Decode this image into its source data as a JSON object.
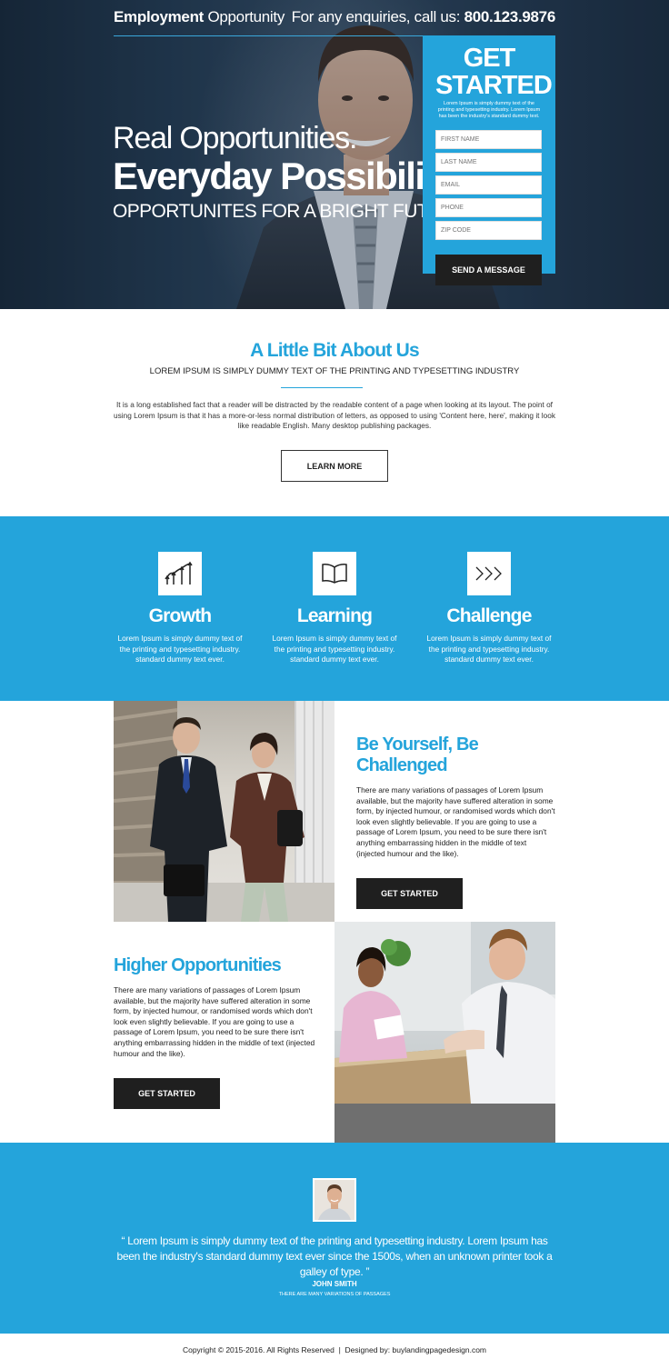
{
  "header": {
    "brand_bold": "Employment",
    "brand_light": " Opportunity",
    "phone_prefix": "For any enquiries, call us: ",
    "phone_number": "800.123.9876"
  },
  "hero": {
    "line1": "Real Opportunities.",
    "line2": "Everyday Possibilities.",
    "line3": "OPPORTUNITES FOR A BRIGHT FUTURE."
  },
  "form": {
    "title": "GET STARTED",
    "description": "Lorem Ipsum is simply dummy text of the printing and typesetting industry. Lorem Ipsum has been the industry's standard dummy text.",
    "fields": [
      {
        "placeholder": "FIRST NAME"
      },
      {
        "placeholder": "LAST NAME"
      },
      {
        "placeholder": "EMAIL"
      },
      {
        "placeholder": "PHONE"
      },
      {
        "placeholder": "ZIP CODE"
      }
    ],
    "submit_label": "SEND A MESSAGE"
  },
  "about": {
    "title": "A Little Bit About Us",
    "subtitle": "LOREM IPSUM IS SIMPLY DUMMY TEXT OF THE PRINTING AND TYPESETTING INDUSTRY",
    "paragraph": "It is a long established fact that a reader will be distracted by the readable content of a page when looking at its layout. The point of using Lorem Ipsum is that it has a more-or-less normal distribution of letters, as opposed to using 'Content here, here', making it look like readable English. Many desktop publishing packages.",
    "button_label": "LEARN MORE"
  },
  "features": [
    {
      "icon": "growth-arrows-icon",
      "title": "Growth",
      "text": "Lorem Ipsum is simply dummy text of the printing and typesetting industry. standard dummy text ever."
    },
    {
      "icon": "open-book-icon",
      "title": "Learning",
      "text": "Lorem Ipsum is simply dummy text of the printing and typesetting industry. standard dummy text ever."
    },
    {
      "icon": "chevrons-right-icon",
      "title": "Challenge",
      "text": "Lorem Ipsum is simply dummy text of the printing and typesetting industry. standard dummy text ever."
    }
  ],
  "section_a": {
    "title": "Be Yourself, Be Challenged",
    "paragraph": "There are many variations of passages of Lorem Ipsum available, but the majority have suffered alteration in some form, by injected humour, or randomised words which don't look even slightly believable. If you are going to use a passage of Lorem Ipsum, you need to be sure there isn't anything embarrassing hidden in the middle of text (injected humour and the like).",
    "button_label": "GET STARTED"
  },
  "section_b": {
    "title": "Higher Opportunities",
    "paragraph": "There are many variations of passages of Lorem Ipsum available, but the majority have suffered alteration in some form, by injected humour, or randomised words which don't look even slightly believable. If you are going to use a passage of Lorem Ipsum, you need to be sure there isn't anything embarrassing hidden in the middle of text (injected humour and the like).",
    "button_label": "GET STARTED"
  },
  "testimonial": {
    "quote": "“ Lorem Ipsum is simply dummy text of the printing and typesetting industry. Lorem Ipsum has been the industry's standard dummy text ever since the 1500s, when an unknown printer took a galley of type. ”",
    "name": "JOHN SMITH",
    "role": "THERE ARE MANY VARIATIONS OF PASSAGES"
  },
  "footer": {
    "text": "Copyright © 2015-2016. All Rights Reserved  |  Designed by: buylandingpagedesign.com"
  },
  "colors": {
    "accent": "#24a4db",
    "dark_button": "#1f1f1f",
    "hero_bg": "#24394f"
  }
}
